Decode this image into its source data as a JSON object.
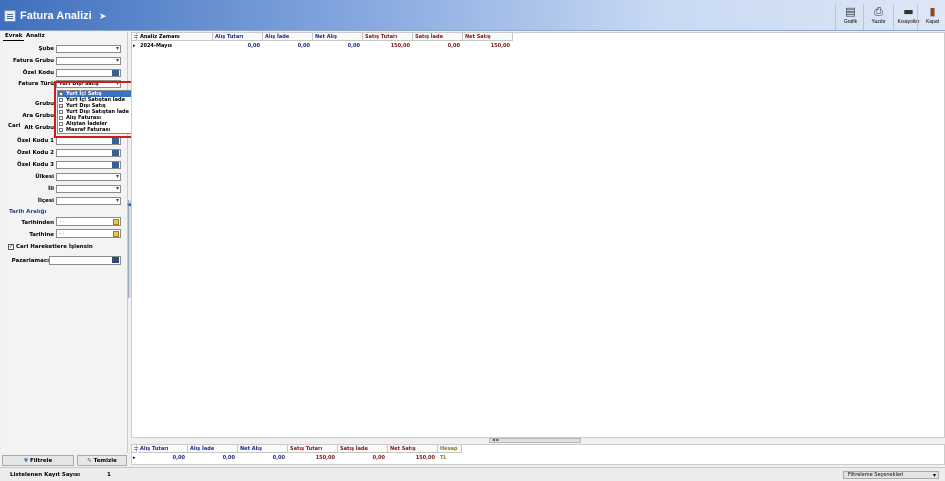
{
  "window": {
    "title": "Fatura Analizi"
  },
  "toolbar": [
    {
      "name": "grafik-button",
      "label": "Grafik",
      "icon": "chart-icon",
      "glyph": "▤"
    },
    {
      "name": "yazdir-button",
      "label": "Yazdır",
      "icon": "printer-icon",
      "glyph": "⎙"
    },
    {
      "name": "kisayollar-button",
      "label": "Kısayollar",
      "icon": "shortcut-icon",
      "glyph": "▬"
    },
    {
      "name": "kapat-button",
      "label": "Kapat",
      "icon": "door-icon",
      "glyph": "▮"
    }
  ],
  "tabs": {
    "evrak": "Evrak",
    "analiz": "Analiz"
  },
  "filters": {
    "sube": "Şube",
    "fatura_grubu": "Fatura Grubu",
    "ozel_kodu": "Özel Kodu",
    "fatura_turu": "Fatura Türü",
    "fatura_turu_value": "Yurt Dışı Satış",
    "cari_partial": "Cari",
    "grubu": "Grubu",
    "ara_grubu": "Ara Grubu",
    "alt_grubu": "Alt Grubu",
    "ozel_kodu_1": "Özel Kodu 1",
    "ozel_kodu_2": "Özel Kodu 2",
    "ozel_kodu_3": "Özel Kodu 3",
    "ulkesi": "Ülkesi",
    "il": "İli",
    "ilcesi": "İlçesi",
    "tarih_araligi": "Tarih Aralığı",
    "tarihinden": "Tarihinden",
    "tarihinden_value": ". .",
    "tarihine": "Tarihine",
    "tarihine_value": ". .",
    "cari_hareket": "Cari Hareketlere İşlensin",
    "cari_hareket_checked": "✓",
    "pazarlamaci": "Pazarlamacı"
  },
  "fatura_turu_options": [
    {
      "label": "Yurt İçi Satış",
      "checked": false,
      "selected": true
    },
    {
      "label": "Yurt İçi Satıştan İade",
      "checked": false,
      "selected": false
    },
    {
      "label": "Yurt Dışı Satış",
      "checked": true,
      "selected": false
    },
    {
      "label": "Yurt Dışı Satıştan İade",
      "checked": false,
      "selected": false
    },
    {
      "label": "Alış Faturası",
      "checked": false,
      "selected": false
    },
    {
      "label": "Alıştan İadeler",
      "checked": false,
      "selected": false
    },
    {
      "label": "Masraf Faturası",
      "checked": false,
      "selected": false
    }
  ],
  "buttons": {
    "filtrele": "Filtrele",
    "temizle": "Temizle"
  },
  "grid": {
    "columns": [
      "Analiz Zamanı",
      "Alış Tutarı",
      "Alış İade",
      "Net Alış",
      "Satış Tutarı",
      "Satış İade",
      "Net Satış"
    ],
    "rows": [
      [
        "2024-Mayıs",
        "0,00",
        "0,00",
        "0,00",
        "150,00",
        "0,00",
        "150,00"
      ]
    ]
  },
  "summary": {
    "columns": [
      "Alış Tutarı",
      "Alış İade",
      "Net Alış",
      "Satış Tutarı",
      "Satış İade",
      "Net Satış",
      "Hesap"
    ],
    "values": [
      "0,00",
      "0,00",
      "0,00",
      "150,00",
      "0,00",
      "150,00",
      "TL"
    ]
  },
  "status": {
    "listed_label": "Listelenen Kayıt Sayısı",
    "listed_count": "1",
    "filter_options": "Filtreleme Seçenekleri"
  },
  "colors": {
    "title_blue": "#3f6fbd",
    "selection": "#3a73c6",
    "highlight_red": "#d11c1c",
    "value_blue": "#1b2b8f",
    "value_red": "#7c1616"
  }
}
